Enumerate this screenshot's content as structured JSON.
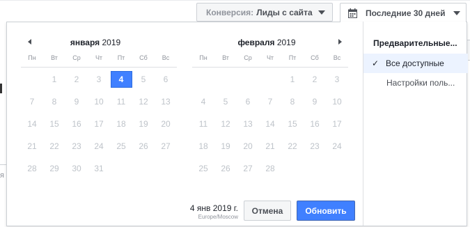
{
  "background": {
    "fragment_letter": "я"
  },
  "toolbar": {
    "conversion_label": "Конверсия:",
    "conversion_value": "Лиды с сайта",
    "date_range_label": "Последние 30 дней"
  },
  "calendars": [
    {
      "month": "января",
      "year": "2019",
      "weekdays": [
        "Пн",
        "Вт",
        "Ср",
        "Чт",
        "Пт",
        "Сб",
        "Вс"
      ],
      "weeks": [
        [
          "",
          "1",
          "2",
          "3",
          "4",
          "5",
          "6"
        ],
        [
          "7",
          "8",
          "9",
          "10",
          "11",
          "12",
          "13"
        ],
        [
          "14",
          "15",
          "16",
          "17",
          "18",
          "19",
          "20"
        ],
        [
          "21",
          "22",
          "23",
          "24",
          "25",
          "26",
          "27"
        ],
        [
          "28",
          "29",
          "30",
          "31",
          "",
          "",
          ""
        ]
      ],
      "selected_day": "4"
    },
    {
      "month": "февраля",
      "year": "2019",
      "weekdays": [
        "Пн",
        "Вт",
        "Ср",
        "Чт",
        "Пт",
        "Сб",
        "Вс"
      ],
      "weeks": [
        [
          "",
          "",
          "",
          "",
          "1",
          "2",
          "3"
        ],
        [
          "4",
          "5",
          "6",
          "7",
          "8",
          "9",
          "10"
        ],
        [
          "11",
          "12",
          "13",
          "14",
          "15",
          "16",
          "17"
        ],
        [
          "18",
          "19",
          "20",
          "21",
          "22",
          "23",
          "24"
        ],
        [
          "25",
          "26",
          "27",
          "28",
          "",
          "",
          ""
        ]
      ],
      "selected_day": ""
    }
  ],
  "presets": {
    "title": "Предварительные...",
    "selected_check": "✓",
    "items": [
      "Все доступные",
      "Настройки поль..."
    ]
  },
  "footer": {
    "date": "4 янв 2019 г.",
    "timezone": "Europe/Moscow",
    "cancel_label": "Отмена",
    "update_label": "Обновить"
  },
  "colors": {
    "accent": "#4080ff",
    "selected_preset_bg": "#ecf3ff",
    "disabled_day": "#bec3c9"
  }
}
